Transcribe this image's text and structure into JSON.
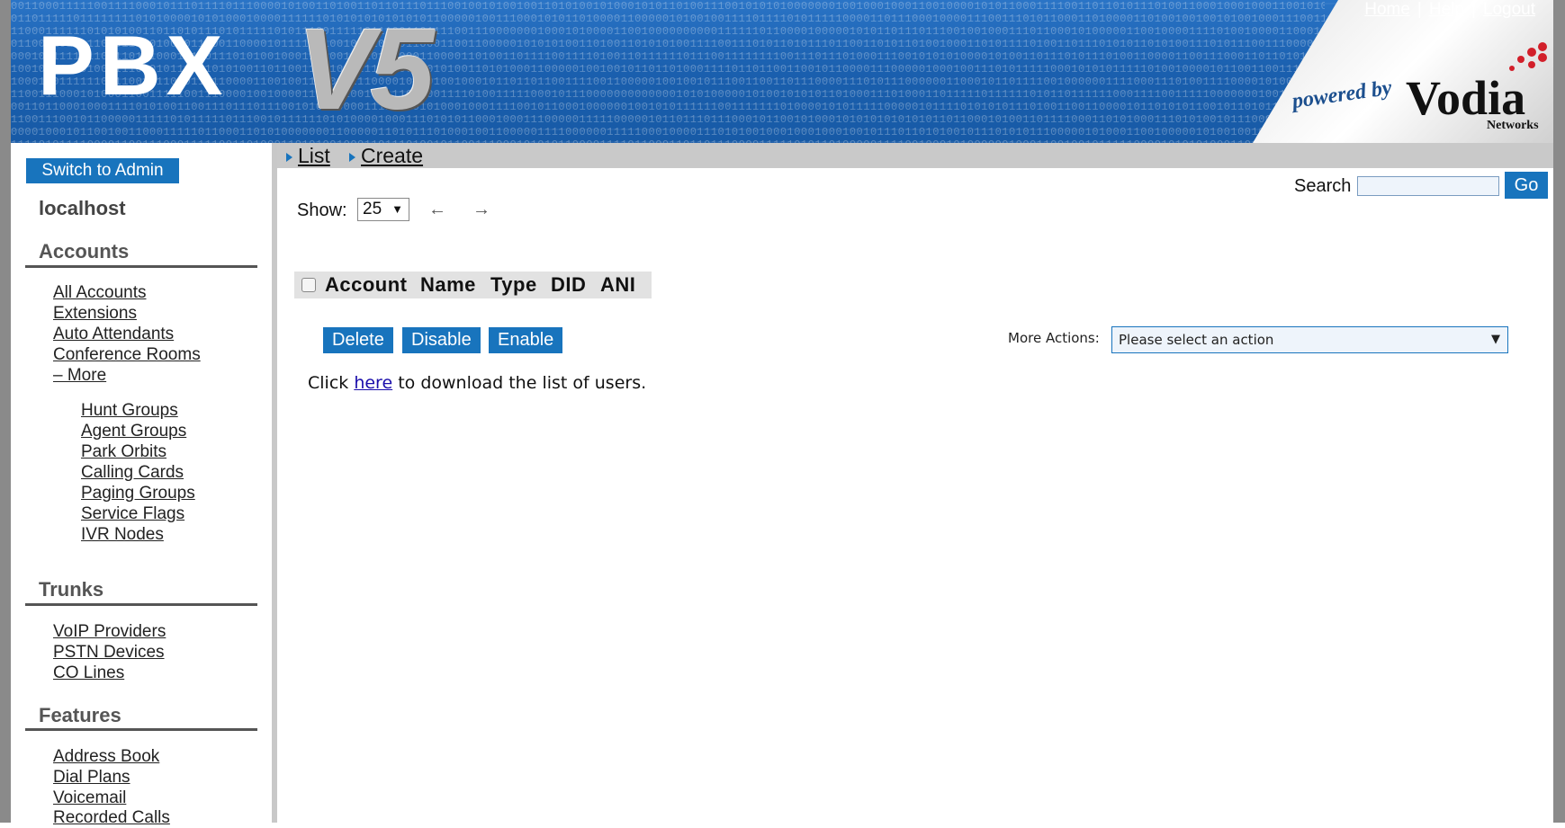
{
  "header": {
    "logo_left": "PBX",
    "logo_right": "V5",
    "powered_by": "powered by",
    "brand": "Vodia",
    "brand_sub": "Networks",
    "links": [
      "Home",
      "Help",
      "Logout"
    ],
    "separator": "|"
  },
  "sidebar": {
    "switch_button": "Switch to Admin",
    "host": "localhost",
    "sections": [
      {
        "title": "Accounts",
        "items": [
          "All Accounts",
          "Extensions",
          "Auto Attendants",
          "Conference Rooms",
          "– More"
        ],
        "sub_items": [
          "Hunt Groups",
          "Agent Groups",
          "Park Orbits",
          "Calling Cards",
          "Paging Groups",
          "Service Flags",
          "IVR Nodes"
        ]
      },
      {
        "title": "Trunks",
        "items": [
          "VoIP Providers",
          "PSTN Devices",
          "CO Lines"
        ]
      },
      {
        "title": "Features",
        "items": [
          "Address Book",
          "Dial Plans",
          "Voicemail",
          "Recorded Calls"
        ]
      }
    ]
  },
  "tabs": [
    "List",
    "Create"
  ],
  "search": {
    "label": "Search",
    "value": "",
    "go": "Go"
  },
  "pager": {
    "show_label": "Show:",
    "page_size": "25",
    "prev": "←",
    "next": "→"
  },
  "table": {
    "columns": [
      "Account",
      "Name",
      "Type",
      "DID",
      "ANI"
    ]
  },
  "actions": {
    "buttons": [
      "Delete",
      "Disable",
      "Enable"
    ],
    "more_label": "More Actions:",
    "more_value": "Please select an action"
  },
  "download": {
    "before": "Click",
    "link": "here",
    "after": "to download the list of users."
  },
  "colors": {
    "accent": "#1874bd",
    "banner": "#1c63b4",
    "tabbar": "#c9c9c9"
  }
}
